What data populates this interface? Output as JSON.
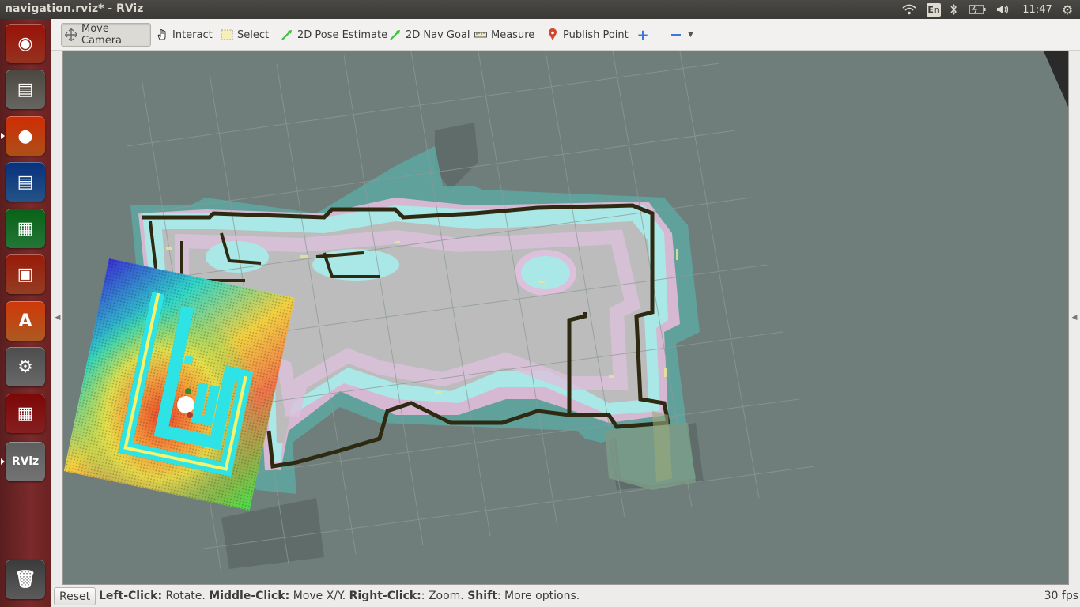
{
  "panel": {
    "window_title": "navigation.rviz* - RViz",
    "keyboard_layout": "En",
    "clock": "11:47"
  },
  "launcher": {
    "items": [
      {
        "name": "ubuntu-dash",
        "glyph": "◉",
        "color": "#c6432b"
      },
      {
        "name": "files",
        "glyph": "▤",
        "color": "#8a8780"
      },
      {
        "name": "firefox",
        "glyph": "●",
        "color": "#e66a1f"
      },
      {
        "name": "libreoffice-writer",
        "glyph": "▤",
        "color": "#2f6fb3"
      },
      {
        "name": "libreoffice-calc",
        "glyph": "▦",
        "color": "#2f9e4a"
      },
      {
        "name": "libreoffice-impress",
        "glyph": "▣",
        "color": "#c5522f"
      },
      {
        "name": "ubuntu-software",
        "glyph": "A",
        "color": "#e6772e"
      },
      {
        "name": "system-settings",
        "glyph": "⚙",
        "color": "#8c8c8c"
      },
      {
        "name": "workspace-switcher",
        "glyph": "▦",
        "color": "#b22a2a"
      },
      {
        "name": "rviz",
        "glyph": "RViz",
        "color": "#9a9a9a"
      },
      {
        "name": "trash",
        "glyph": "🗑",
        "color": "#7a7a7a"
      }
    ]
  },
  "toolbar": {
    "tools": [
      {
        "label": "Move Camera",
        "icon": "move-camera-icon",
        "active": true
      },
      {
        "label": "Interact",
        "icon": "hand-icon",
        "active": false
      },
      {
        "label": "Select",
        "icon": "select-icon",
        "active": false
      },
      {
        "label": "2D Pose Estimate",
        "icon": "pose-arrow-icon",
        "active": false
      },
      {
        "label": "2D Nav Goal",
        "icon": "nav-goal-icon",
        "active": false
      },
      {
        "label": "Measure",
        "icon": "ruler-icon",
        "active": false
      },
      {
        "label": "Publish Point",
        "icon": "map-pin-icon",
        "active": false
      }
    ],
    "add_tool_icon": "plus-icon",
    "remove_tool_icon": "minus-icon"
  },
  "viewport": {
    "colors": {
      "background": "#6f7e7b",
      "free_space": "#bcbcbc",
      "wall": "#2e2a12",
      "inflation_cyan": "#9ee6e4",
      "inflation_pink": "#e6b9d6",
      "grid": "#8d9a97"
    }
  },
  "statusbar": {
    "reset_label": "Reset",
    "help": [
      {
        "key": "Left-Click:",
        "text": " Rotate. "
      },
      {
        "key": "Middle-Click:",
        "text": " Move X/Y. "
      },
      {
        "key": "Right-Click:",
        "text": ": Zoom. "
      },
      {
        "key": "Shift",
        "text": ": More options."
      }
    ],
    "fps": "30 fps"
  }
}
